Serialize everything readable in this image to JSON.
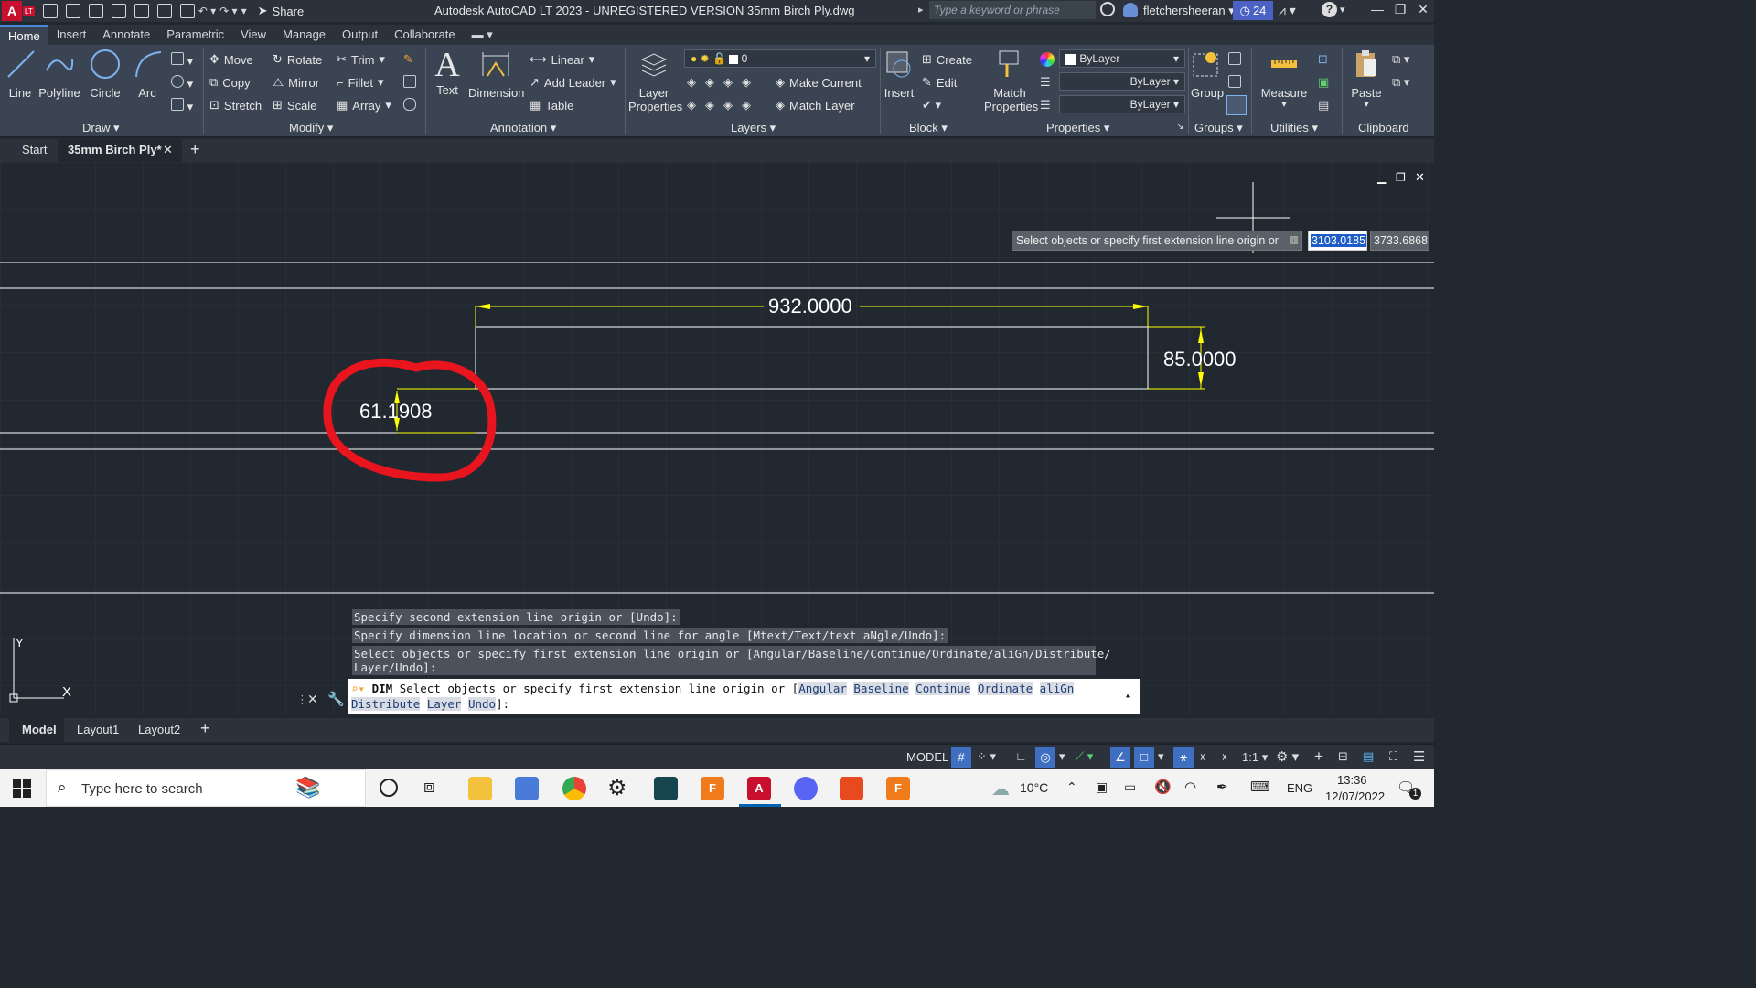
{
  "titlebar": {
    "app_letter": "A",
    "app_suffix": "LT",
    "share_label": "Share",
    "title": "Autodesk AutoCAD LT 2023 - UNREGISTERED VERSION    35mm Birch Ply.dwg",
    "search_placeholder": "Type a keyword or phrase",
    "user": "fletchersheeran",
    "trial_days": "24",
    "help": "?"
  },
  "ribbon_tabs": [
    "Home",
    "Insert",
    "Annotate",
    "Parametric",
    "View",
    "Manage",
    "Output",
    "Collaborate"
  ],
  "ribbon": {
    "draw": {
      "line": "Line",
      "polyline": "Polyline",
      "circle": "Circle",
      "arc": "Arc",
      "title": "Draw"
    },
    "modify": {
      "move": "Move",
      "rotate": "Rotate",
      "trim": "Trim",
      "copy": "Copy",
      "mirror": "Mirror",
      "fillet": "Fillet",
      "stretch": "Stretch",
      "scale": "Scale",
      "array": "Array",
      "title": "Modify"
    },
    "annotation": {
      "text": "Text",
      "dimension": "Dimension",
      "linear": "Linear",
      "add_leader": "Add Leader",
      "table": "Table",
      "title": "Annotation"
    },
    "layers": {
      "layer_props_1": "Layer",
      "layer_props_2": "Properties",
      "current_layer": "0",
      "make_current": "Make Current",
      "match_layer": "Match Layer",
      "title": "Layers"
    },
    "block": {
      "insert": "Insert",
      "create": "Create",
      "edit": "Edit",
      "title": "Block"
    },
    "properties": {
      "match_1": "Match",
      "match_2": "Properties",
      "color": "ByLayer",
      "linetype": "ByLayer",
      "lineweight": "ByLayer",
      "title": "Properties"
    },
    "groups": {
      "group": "Group",
      "title": "Groups"
    },
    "utilities": {
      "measure": "Measure",
      "title": "Utilities"
    },
    "clipboard": {
      "paste": "Paste",
      "title": "Clipboard"
    }
  },
  "file_tabs": {
    "start": "Start",
    "active": "35mm Birch Ply*",
    "add": "+"
  },
  "canvas": {
    "prompt_tooltip": "Select objects or specify first extension line origin or",
    "coord_x": "3103.0185",
    "coord_y": "3733.6868",
    "dim_horizontal": "932.0000",
    "dim_vertical": "85.0000",
    "dim_small": "61.1908",
    "ucs_y": "Y",
    "ucs_x": "X"
  },
  "command_history": [
    "Specify second extension line origin or [Undo]:",
    "Specify dimension line location or second line for angle [Mtext/Text/text aNgle/Undo]:",
    "Select objects or specify first extension line origin or [Angular/Baseline/Continue/Ordinate/aliGn/Distribute/",
    "Layer/Undo]:"
  ],
  "command_line": {
    "prefix": "DIM",
    "prompt": "Select objects or specify first extension line origin or [",
    "options": [
      "Angular",
      "Baseline",
      "Continue",
      "Ordinate",
      "aliGn",
      "Distribute",
      "Layer",
      "Undo"
    ],
    "suffix": "]:"
  },
  "layout_tabs": [
    "Model",
    "Layout1",
    "Layout2"
  ],
  "status": {
    "model": "MODEL",
    "scale": "1:1"
  },
  "taskbar": {
    "search": "Type here to search",
    "temp": "10°C",
    "lang": "ENG",
    "time": "13:36",
    "date": "12/07/2022",
    "notifications": "1"
  },
  "colors": {
    "accent": "#4b62c4",
    "dimension": "#ffff00",
    "annotation_circle": "#e8141e",
    "background": "#212830"
  }
}
